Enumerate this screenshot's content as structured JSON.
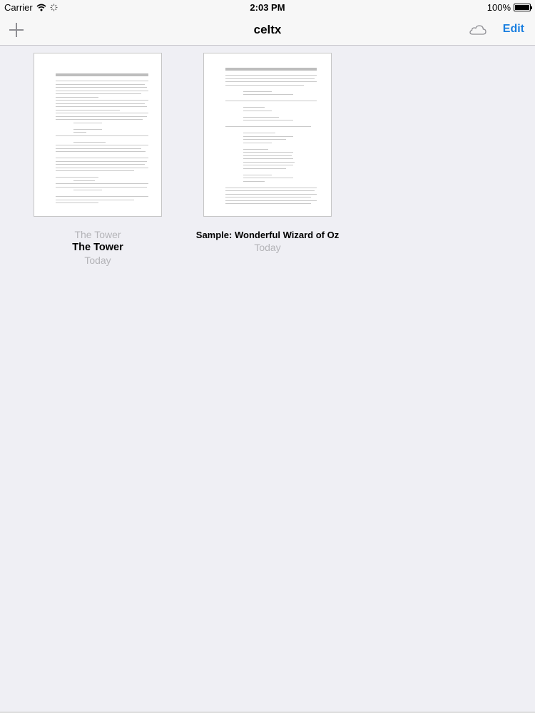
{
  "status": {
    "carrier": "Carrier",
    "time": "2:03 PM",
    "battery": "100%",
    "battery_level": 1.0
  },
  "nav": {
    "title": "celtx",
    "edit_label": "Edit",
    "add_icon": "plus-icon",
    "cloud_icon": "cloud-icon"
  },
  "documents": [
    {
      "name_faded": "The Tower",
      "name": "The Tower",
      "date": "Today"
    },
    {
      "name": "Sample: Wonderful Wizard of Oz",
      "date": "Today"
    }
  ]
}
